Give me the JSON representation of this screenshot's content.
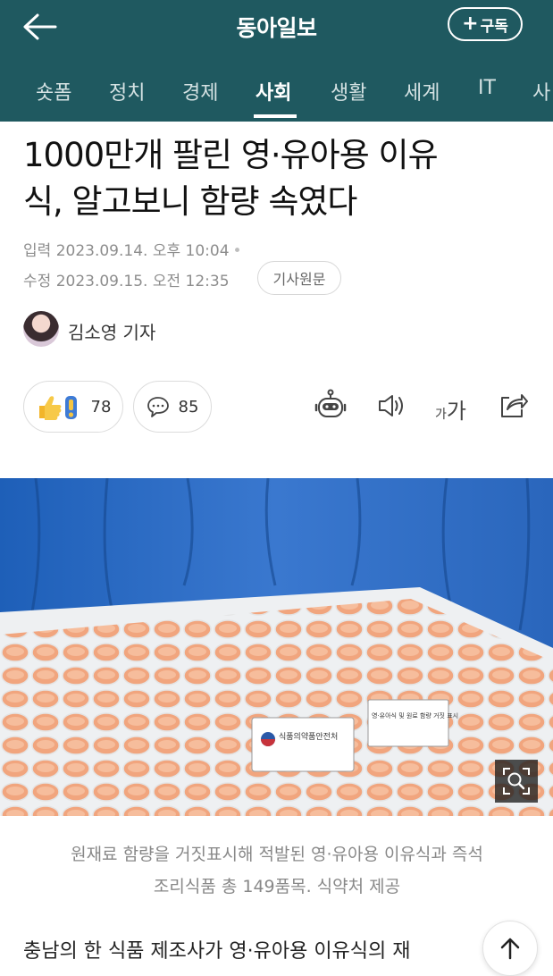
{
  "header": {
    "brand": "동아일보",
    "subscribe_plus": "+",
    "subscribe_label": "구독"
  },
  "tabs": [
    {
      "label": "숏폼"
    },
    {
      "label": "정치"
    },
    {
      "label": "경제"
    },
    {
      "label": "사회",
      "active": true
    },
    {
      "label": "생활"
    },
    {
      "label": "세계"
    },
    {
      "label": "IT"
    },
    {
      "label": "사"
    }
  ],
  "article": {
    "headline_line1": "1000만개 팔린 영·유아용 이유",
    "headline_line2": "식, 알고보니 함량 속였다",
    "input_label": "입력",
    "input_time": "2023.09.14. 오후 10:04",
    "modified_label": "수정",
    "modified_time": "2023.09.15. 오전 12:35",
    "original_button": "기사원문",
    "reporter": "김소영 기자"
  },
  "reactions": {
    "like_count": "78",
    "comment_count": "85",
    "font_small": "가",
    "font_large": "가"
  },
  "photo": {
    "caption_line1": "원재료 함량을 거짓표시해 적발된 영·유아용 이유식과 즉석",
    "caption_line2": "조리식품 총 149품목. 식약처 제공",
    "sign_text": "식품의약품안전처",
    "label_text": "영·유아식 및 원료 함량 거짓 표시"
  },
  "body": {
    "first_line": "충남의 한 식품 제조사가 영·유아용 이유식의 재"
  },
  "colors": {
    "header_bg": "#1f5960",
    "text": "#222222",
    "meta": "#8d8d8d"
  }
}
